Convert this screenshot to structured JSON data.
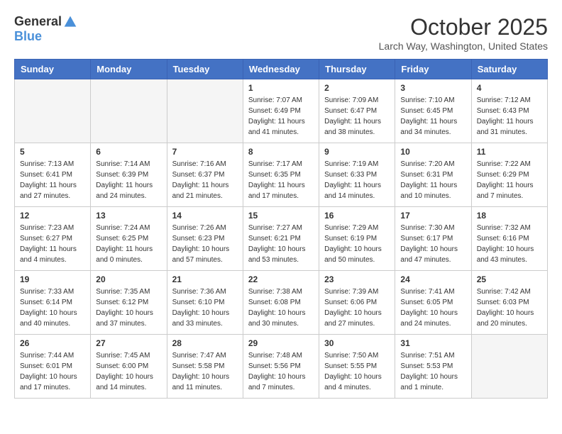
{
  "header": {
    "logo_general": "General",
    "logo_blue": "Blue",
    "month_title": "October 2025",
    "location": "Larch Way, Washington, United States"
  },
  "weekdays": [
    "Sunday",
    "Monday",
    "Tuesday",
    "Wednesday",
    "Thursday",
    "Friday",
    "Saturday"
  ],
  "weeks": [
    [
      {
        "day": "",
        "info": ""
      },
      {
        "day": "",
        "info": ""
      },
      {
        "day": "",
        "info": ""
      },
      {
        "day": "1",
        "info": "Sunrise: 7:07 AM\nSunset: 6:49 PM\nDaylight: 11 hours\nand 41 minutes."
      },
      {
        "day": "2",
        "info": "Sunrise: 7:09 AM\nSunset: 6:47 PM\nDaylight: 11 hours\nand 38 minutes."
      },
      {
        "day": "3",
        "info": "Sunrise: 7:10 AM\nSunset: 6:45 PM\nDaylight: 11 hours\nand 34 minutes."
      },
      {
        "day": "4",
        "info": "Sunrise: 7:12 AM\nSunset: 6:43 PM\nDaylight: 11 hours\nand 31 minutes."
      }
    ],
    [
      {
        "day": "5",
        "info": "Sunrise: 7:13 AM\nSunset: 6:41 PM\nDaylight: 11 hours\nand 27 minutes."
      },
      {
        "day": "6",
        "info": "Sunrise: 7:14 AM\nSunset: 6:39 PM\nDaylight: 11 hours\nand 24 minutes."
      },
      {
        "day": "7",
        "info": "Sunrise: 7:16 AM\nSunset: 6:37 PM\nDaylight: 11 hours\nand 21 minutes."
      },
      {
        "day": "8",
        "info": "Sunrise: 7:17 AM\nSunset: 6:35 PM\nDaylight: 11 hours\nand 17 minutes."
      },
      {
        "day": "9",
        "info": "Sunrise: 7:19 AM\nSunset: 6:33 PM\nDaylight: 11 hours\nand 14 minutes."
      },
      {
        "day": "10",
        "info": "Sunrise: 7:20 AM\nSunset: 6:31 PM\nDaylight: 11 hours\nand 10 minutes."
      },
      {
        "day": "11",
        "info": "Sunrise: 7:22 AM\nSunset: 6:29 PM\nDaylight: 11 hours\nand 7 minutes."
      }
    ],
    [
      {
        "day": "12",
        "info": "Sunrise: 7:23 AM\nSunset: 6:27 PM\nDaylight: 11 hours\nand 4 minutes."
      },
      {
        "day": "13",
        "info": "Sunrise: 7:24 AM\nSunset: 6:25 PM\nDaylight: 11 hours\nand 0 minutes."
      },
      {
        "day": "14",
        "info": "Sunrise: 7:26 AM\nSunset: 6:23 PM\nDaylight: 10 hours\nand 57 minutes."
      },
      {
        "day": "15",
        "info": "Sunrise: 7:27 AM\nSunset: 6:21 PM\nDaylight: 10 hours\nand 53 minutes."
      },
      {
        "day": "16",
        "info": "Sunrise: 7:29 AM\nSunset: 6:19 PM\nDaylight: 10 hours\nand 50 minutes."
      },
      {
        "day": "17",
        "info": "Sunrise: 7:30 AM\nSunset: 6:17 PM\nDaylight: 10 hours\nand 47 minutes."
      },
      {
        "day": "18",
        "info": "Sunrise: 7:32 AM\nSunset: 6:16 PM\nDaylight: 10 hours\nand 43 minutes."
      }
    ],
    [
      {
        "day": "19",
        "info": "Sunrise: 7:33 AM\nSunset: 6:14 PM\nDaylight: 10 hours\nand 40 minutes."
      },
      {
        "day": "20",
        "info": "Sunrise: 7:35 AM\nSunset: 6:12 PM\nDaylight: 10 hours\nand 37 minutes."
      },
      {
        "day": "21",
        "info": "Sunrise: 7:36 AM\nSunset: 6:10 PM\nDaylight: 10 hours\nand 33 minutes."
      },
      {
        "day": "22",
        "info": "Sunrise: 7:38 AM\nSunset: 6:08 PM\nDaylight: 10 hours\nand 30 minutes."
      },
      {
        "day": "23",
        "info": "Sunrise: 7:39 AM\nSunset: 6:06 PM\nDaylight: 10 hours\nand 27 minutes."
      },
      {
        "day": "24",
        "info": "Sunrise: 7:41 AM\nSunset: 6:05 PM\nDaylight: 10 hours\nand 24 minutes."
      },
      {
        "day": "25",
        "info": "Sunrise: 7:42 AM\nSunset: 6:03 PM\nDaylight: 10 hours\nand 20 minutes."
      }
    ],
    [
      {
        "day": "26",
        "info": "Sunrise: 7:44 AM\nSunset: 6:01 PM\nDaylight: 10 hours\nand 17 minutes."
      },
      {
        "day": "27",
        "info": "Sunrise: 7:45 AM\nSunset: 6:00 PM\nDaylight: 10 hours\nand 14 minutes."
      },
      {
        "day": "28",
        "info": "Sunrise: 7:47 AM\nSunset: 5:58 PM\nDaylight: 10 hours\nand 11 minutes."
      },
      {
        "day": "29",
        "info": "Sunrise: 7:48 AM\nSunset: 5:56 PM\nDaylight: 10 hours\nand 7 minutes."
      },
      {
        "day": "30",
        "info": "Sunrise: 7:50 AM\nSunset: 5:55 PM\nDaylight: 10 hours\nand 4 minutes."
      },
      {
        "day": "31",
        "info": "Sunrise: 7:51 AM\nSunset: 5:53 PM\nDaylight: 10 hours\nand 1 minute."
      },
      {
        "day": "",
        "info": ""
      }
    ]
  ]
}
